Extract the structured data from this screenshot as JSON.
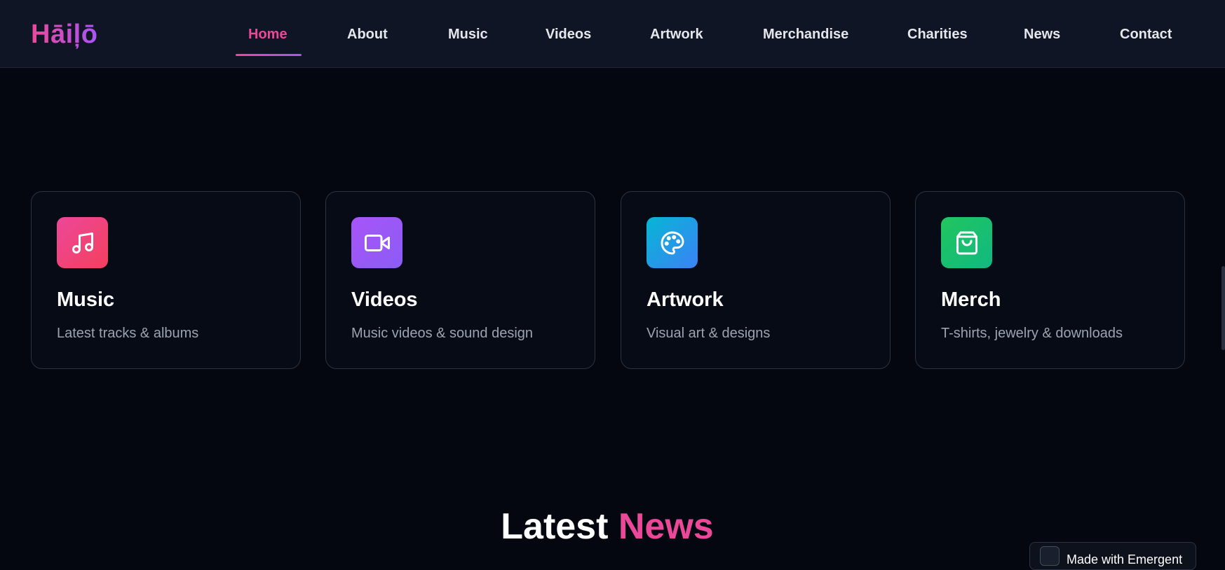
{
  "brand": {
    "name": "Hāiļō"
  },
  "nav": {
    "items": [
      {
        "label": "Home",
        "active": true
      },
      {
        "label": "About"
      },
      {
        "label": "Music"
      },
      {
        "label": "Videos"
      },
      {
        "label": "Artwork"
      },
      {
        "label": "Merchandise"
      },
      {
        "label": "Charities"
      },
      {
        "label": "News"
      },
      {
        "label": "Contact"
      }
    ]
  },
  "categories": [
    {
      "title": "Music",
      "description": "Latest tracks & albums",
      "icon": "music-note-icon",
      "gradient": [
        "#ec4899",
        "#f43f5e"
      ]
    },
    {
      "title": "Videos",
      "description": "Music videos & sound design",
      "icon": "video-camera-icon",
      "gradient": [
        "#a855f7",
        "#8b5cf6"
      ]
    },
    {
      "title": "Artwork",
      "description": "Visual art & designs",
      "icon": "palette-icon",
      "gradient": [
        "#06b6d4",
        "#3b82f6"
      ]
    },
    {
      "title": "Merch",
      "description": "T-shirts, jewelry & downloads",
      "icon": "shopping-bag-icon",
      "gradient": [
        "#22c55e",
        "#10b981"
      ]
    }
  ],
  "news_section": {
    "title_part1": "Latest",
    "title_part2": "News"
  },
  "badge": {
    "text": "Made with Emergent"
  },
  "colors": {
    "accent": "#ec4899",
    "background": "#04070f",
    "navbar": "#101526"
  }
}
